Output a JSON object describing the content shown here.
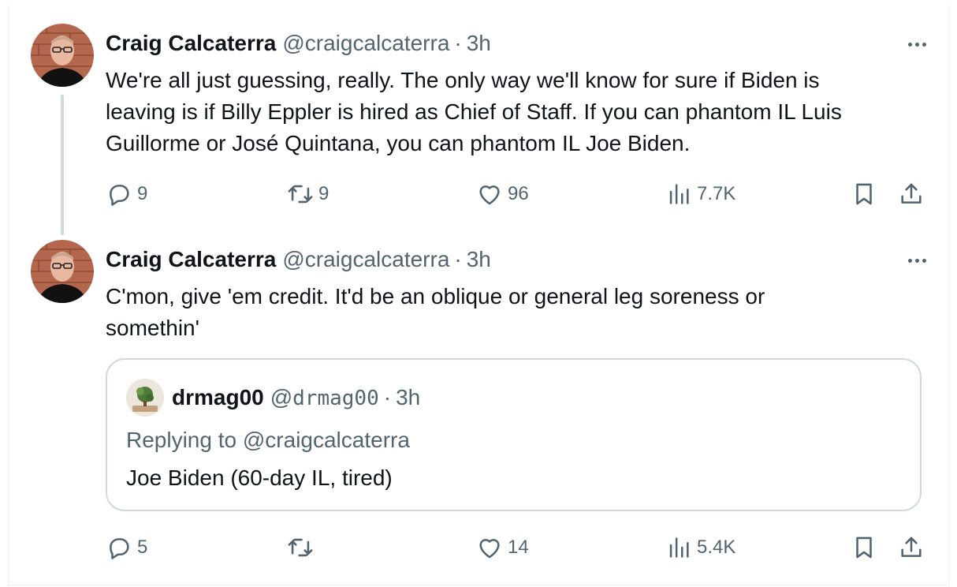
{
  "tweets": [
    {
      "author_name": "Craig Calcaterra",
      "handle": "@craigcalcaterra",
      "separator": "·",
      "time": "3h",
      "lines": [
        "We're all just guessing, really. The only way we'll know for sure if Biden is",
        "leaving is if Billy Eppler is hired as Chief of Staff. If you can phantom IL Luis",
        "Guillorme or José Quintana, you can phantom IL Joe Biden."
      ],
      "replies": "9",
      "reposts": "9",
      "likes": "96",
      "views": "7.7K"
    },
    {
      "author_name": "Craig Calcaterra",
      "handle": "@craigcalcaterra",
      "separator": "·",
      "time": "3h",
      "lines": [
        "C'mon, give 'em credit. It'd be an oblique or general leg soreness or",
        "somethin'"
      ],
      "replies": "5",
      "reposts": "",
      "likes": "14",
      "views": "5.4K",
      "quote": {
        "author_name": "drmag00",
        "handle_prefix": "@",
        "handle_mono": "drmag00",
        "separator": "·",
        "time": "3h",
        "replying_prefix": "Replying to ",
        "replying_to": "@craigcalcaterra",
        "text": "Joe Biden (60-day IL, tired)"
      }
    }
  ],
  "icons": {
    "reply": "reply-icon",
    "repost": "repost-icon",
    "like": "heart-icon",
    "views": "views-icon",
    "bookmark": "bookmark-icon",
    "share": "share-icon",
    "more": "more-icon"
  },
  "colors": {
    "text": "#0f1419",
    "secondary": "#536471",
    "border": "#cfd9de"
  }
}
